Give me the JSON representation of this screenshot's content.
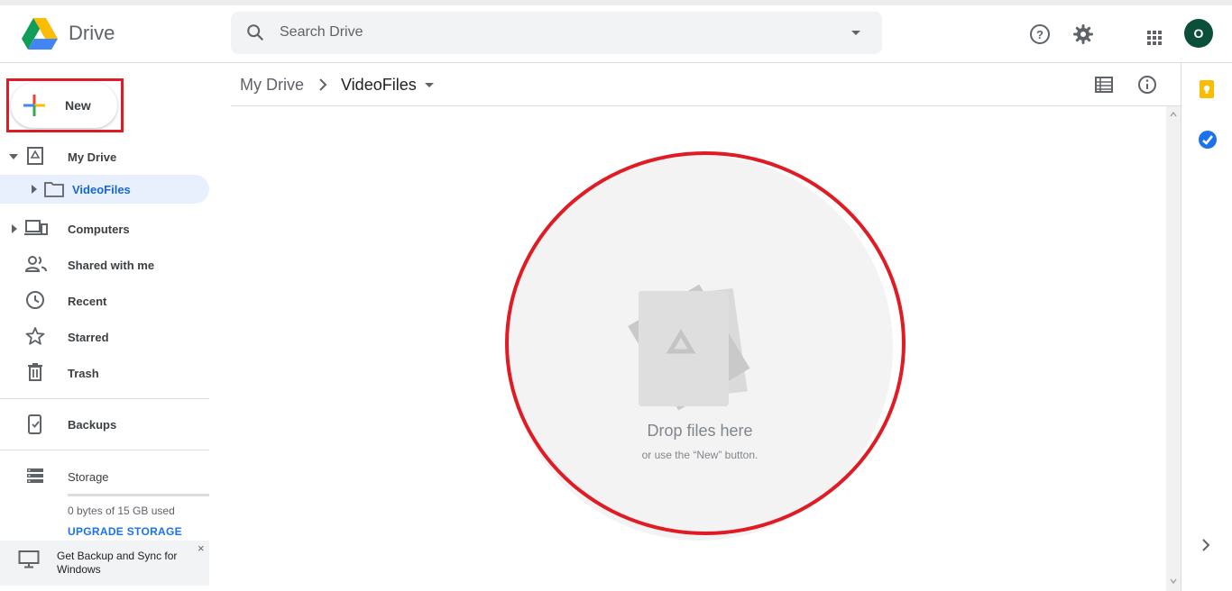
{
  "app": {
    "title": "Drive"
  },
  "search": {
    "placeholder": "Search Drive"
  },
  "account": {
    "avatar_letter": "O",
    "avatar_color": "#0b4f3a"
  },
  "sidebar": {
    "new_label": "New",
    "items": [
      {
        "label": "My Drive"
      },
      {
        "label": "VideoFiles"
      },
      {
        "label": "Computers"
      },
      {
        "label": "Shared with me"
      },
      {
        "label": "Recent"
      },
      {
        "label": "Starred"
      },
      {
        "label": "Trash"
      },
      {
        "label": "Backups"
      },
      {
        "label": "Storage"
      }
    ],
    "storage_used_text": "0 bytes of 15 GB used",
    "storage_used_fraction": 0,
    "upgrade_label": "UPGRADE STORAGE",
    "promo_text": "Get Backup and Sync for Windows",
    "promo_close": "×"
  },
  "breadcrumb": {
    "root": "My Drive",
    "current": "VideoFiles"
  },
  "empty_state": {
    "title": "Drop files here",
    "subtitle": "or use the “New” button."
  },
  "colors": {
    "accent": "#1a73e8",
    "highlight": "#e01b24",
    "active_bg": "#e8f0fe"
  }
}
